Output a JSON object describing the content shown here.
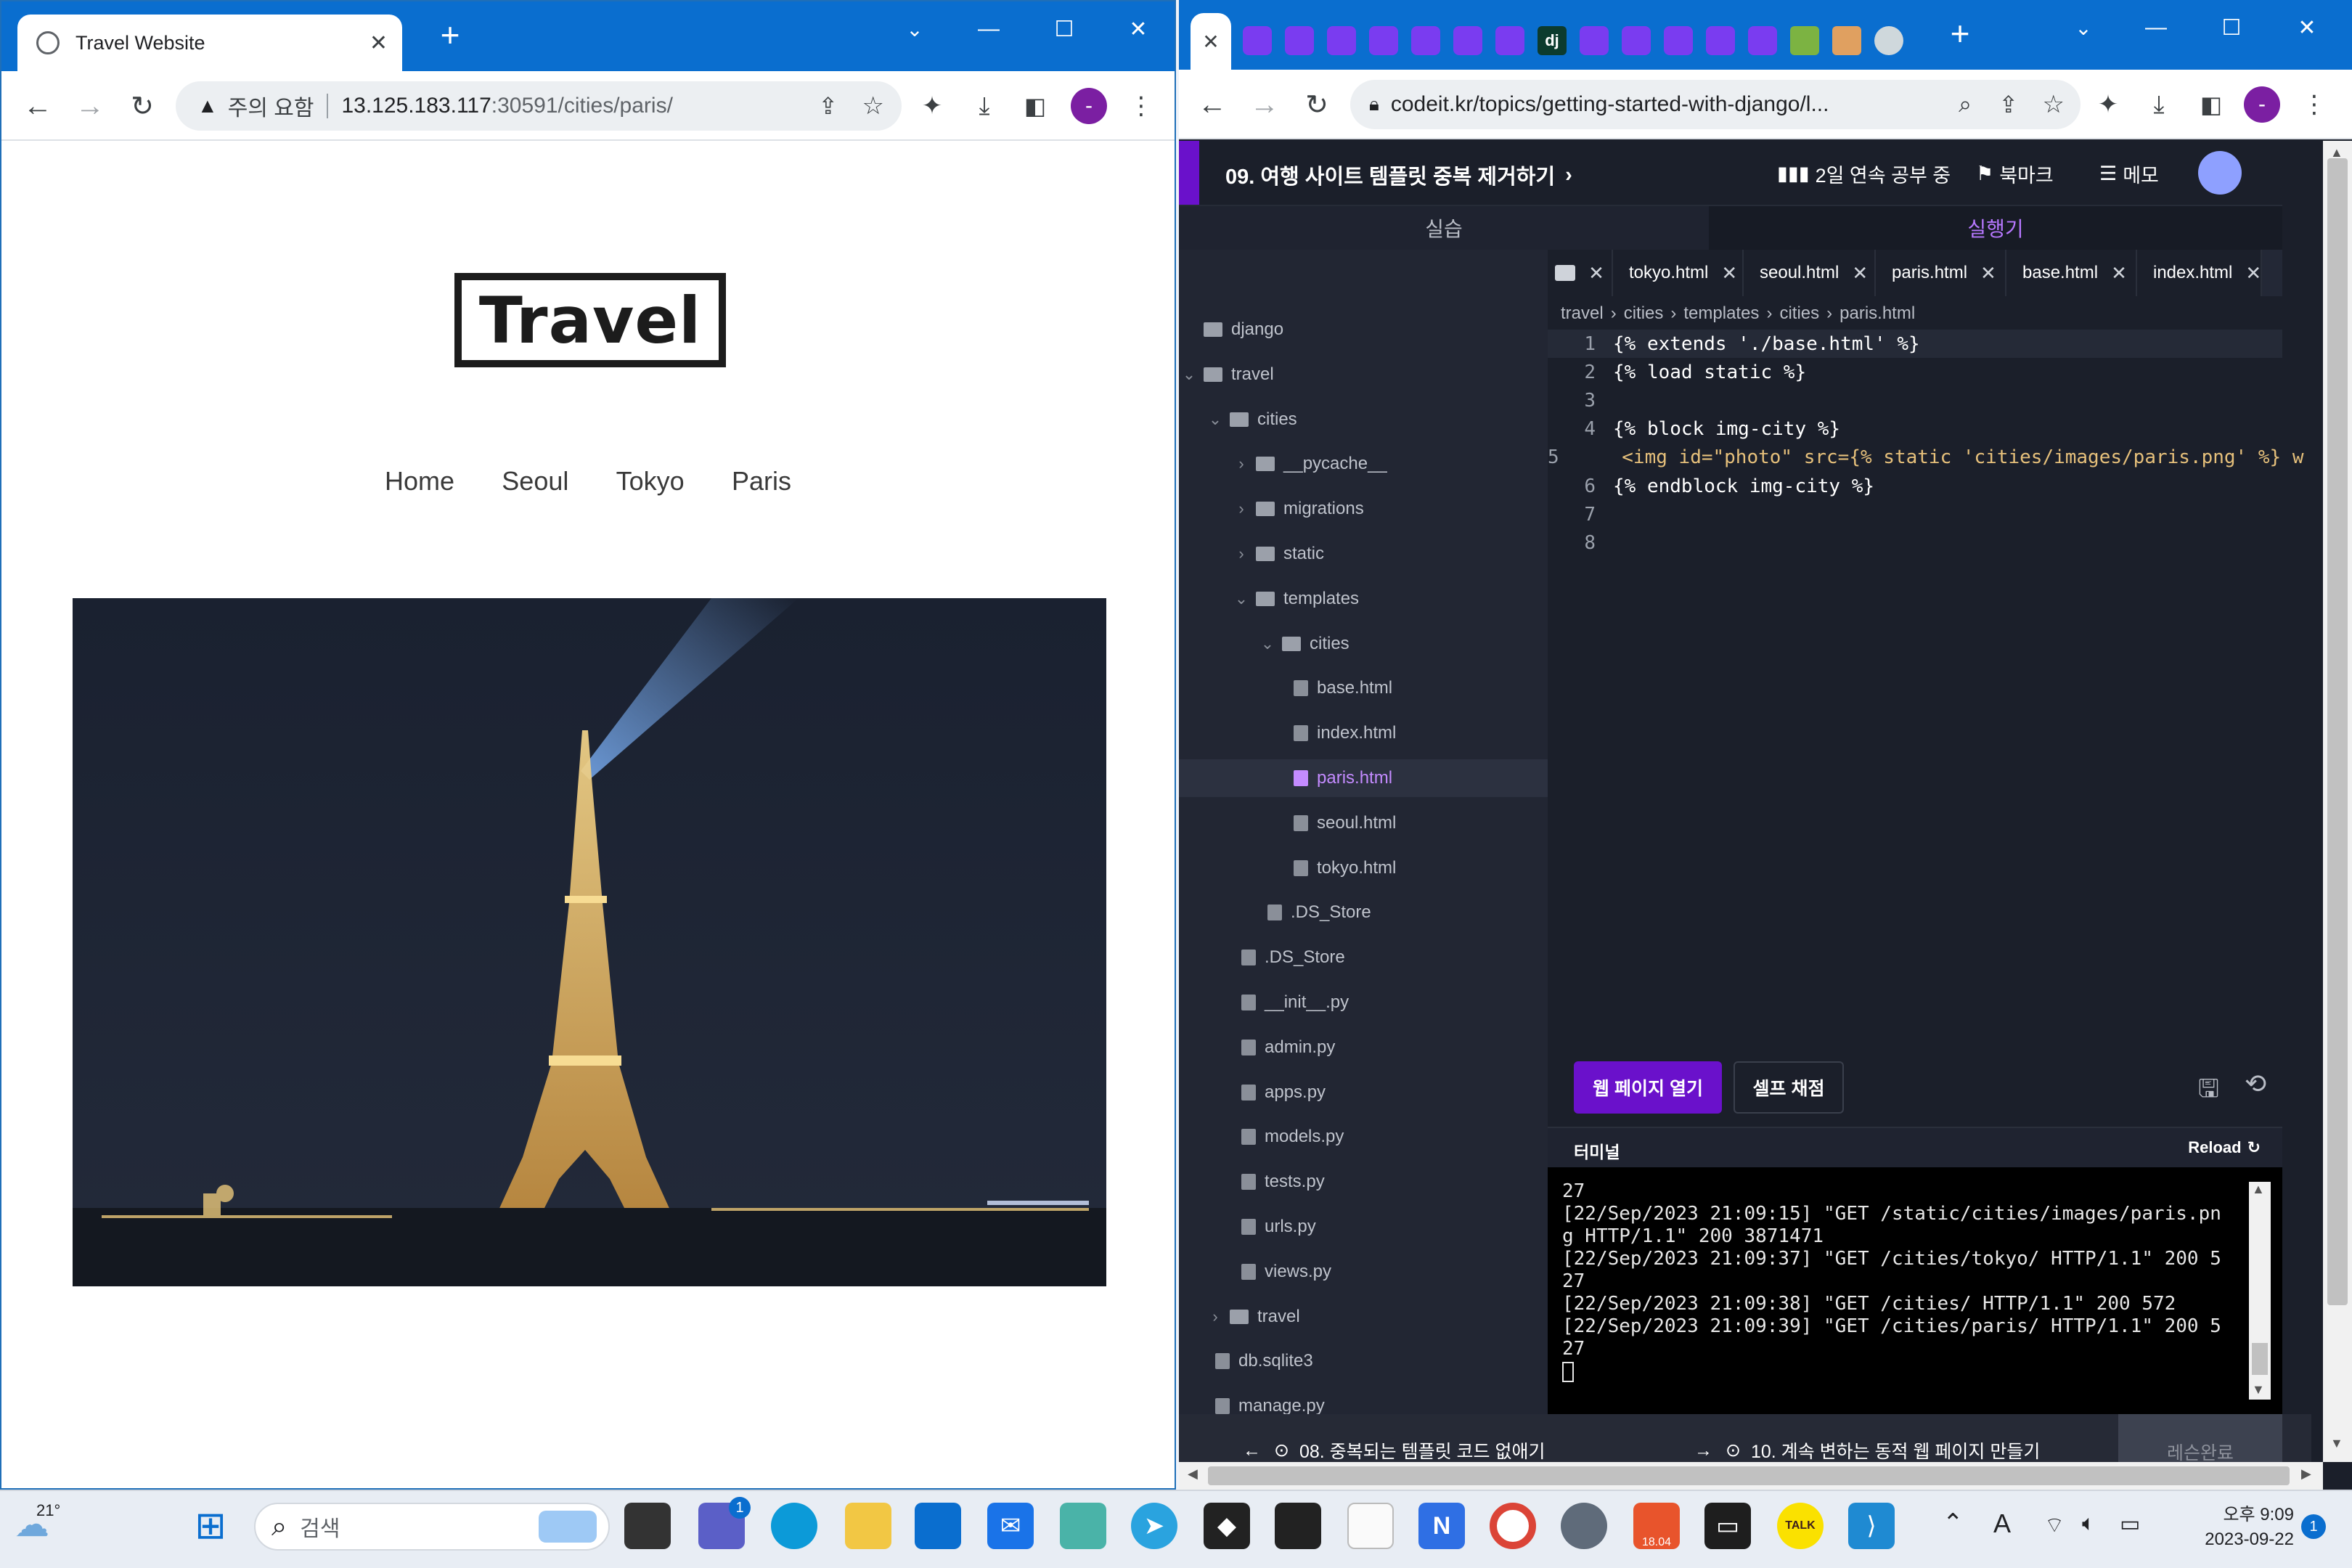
{
  "left_browser": {
    "tab_title": "Travel Website",
    "security_label": "주의 요함",
    "url_host": "13.125.183.117",
    "url_rest": ":30591/cities/paris/",
    "profile_initial": "-",
    "site": {
      "logo": "Travel",
      "nav": [
        "Home",
        "Seoul",
        "Tokyo",
        "Paris"
      ]
    }
  },
  "right_browser": {
    "url": "codeit.kr/topics/getting-started-with-django/l...",
    "profile_initial": "-",
    "tab_favicon_dj": "dj",
    "course": {
      "lesson_title": "09. 여행 사이트 템플릿 중복 제거하기",
      "streak": "2일 연속 공부 중",
      "bookmark": "북마크",
      "memo": "메모",
      "pane_practice": "실습",
      "pane_runner": "실행기"
    },
    "file_tree": [
      {
        "label": "django",
        "type": "folder",
        "depth": 0,
        "open": null
      },
      {
        "label": "travel",
        "type": "folder",
        "depth": 0,
        "open": true
      },
      {
        "label": "cities",
        "type": "folder",
        "depth": 1,
        "open": true
      },
      {
        "label": "__pycache__",
        "type": "folder",
        "depth": 2,
        "open": false
      },
      {
        "label": "migrations",
        "type": "folder",
        "depth": 2,
        "open": false
      },
      {
        "label": "static",
        "type": "folder",
        "depth": 2,
        "open": false
      },
      {
        "label": "templates",
        "type": "folder",
        "depth": 2,
        "open": true
      },
      {
        "label": "cities",
        "type": "folder",
        "depth": 3,
        "open": true
      },
      {
        "label": "base.html",
        "type": "file",
        "depth": 4
      },
      {
        "label": "index.html",
        "type": "file",
        "depth": 4
      },
      {
        "label": "paris.html",
        "type": "file",
        "depth": 4,
        "active": true
      },
      {
        "label": "seoul.html",
        "type": "file",
        "depth": 4
      },
      {
        "label": "tokyo.html",
        "type": "file",
        "depth": 4
      },
      {
        "label": ".DS_Store",
        "type": "file",
        "depth": 3
      },
      {
        "label": ".DS_Store",
        "type": "file",
        "depth": 2
      },
      {
        "label": "__init__.py",
        "type": "file",
        "depth": 2
      },
      {
        "label": "admin.py",
        "type": "file",
        "depth": 2
      },
      {
        "label": "apps.py",
        "type": "file",
        "depth": 2
      },
      {
        "label": "models.py",
        "type": "file",
        "depth": 2
      },
      {
        "label": "tests.py",
        "type": "file",
        "depth": 2
      },
      {
        "label": "urls.py",
        "type": "file",
        "depth": 2
      },
      {
        "label": "views.py",
        "type": "file",
        "depth": 2
      },
      {
        "label": "travel",
        "type": "folder",
        "depth": 1,
        "open": false
      },
      {
        "label": "db.sqlite3",
        "type": "file",
        "depth": 1
      },
      {
        "label": "manage.py",
        "type": "file",
        "depth": 1
      }
    ],
    "editor_tabs": [
      "tokyo.html",
      "seoul.html",
      "paris.html",
      "base.html",
      "index.html"
    ],
    "active_editor_tab": "paris.html",
    "breadcrumb": [
      "travel",
      "cities",
      "templates",
      "cities",
      "paris.html"
    ],
    "code_lines": [
      "{% extends './base.html' %}",
      "{% load static %}",
      "",
      "{% block img-city %}",
      "    <img id=\"photo\" src={% static 'cities/images/paris.png' %} w",
      "{% endblock img-city %}",
      "",
      ""
    ],
    "open_page_button": "웹 페이지 열기",
    "self_grade_button": "셀프 채점",
    "terminal_label": "터미널",
    "reload_label": "Reload",
    "terminal_lines": [
      "27",
      "[22/Sep/2023 21:09:15] \"GET /static/cities/images/paris.pn",
      "g HTTP/1.1\" 200 3871471",
      "[22/Sep/2023 21:09:37] \"GET /cities/tokyo/ HTTP/1.1\" 200 5",
      "27",
      "[22/Sep/2023 21:09:38] \"GET /cities/ HTTP/1.1\" 200 572",
      "[22/Sep/2023 21:09:39] \"GET /cities/paris/ HTTP/1.1\" 200 5",
      "27"
    ],
    "prev_lesson": "08. 중복되는 템플릿 코드 없애기",
    "next_lesson": "10. 계속 변하는 동적 웹 페이지 만들기",
    "complete_button": "레슨완료"
  },
  "taskbar": {
    "weather_temp": "21°",
    "search_placeholder": "검색",
    "chat_badge": "1",
    "time": "오후 9:09",
    "date": "2023-09-22",
    "notification_count": "1",
    "ime": "A",
    "office_badge": "18.04",
    "kakao_label": "TALK"
  },
  "colors": {
    "titlebar_blue": "#0a6ecf",
    "codeit_purple": "#6a11cb",
    "editor_bg": "#1b1f2a",
    "tree_bg": "#222633"
  }
}
